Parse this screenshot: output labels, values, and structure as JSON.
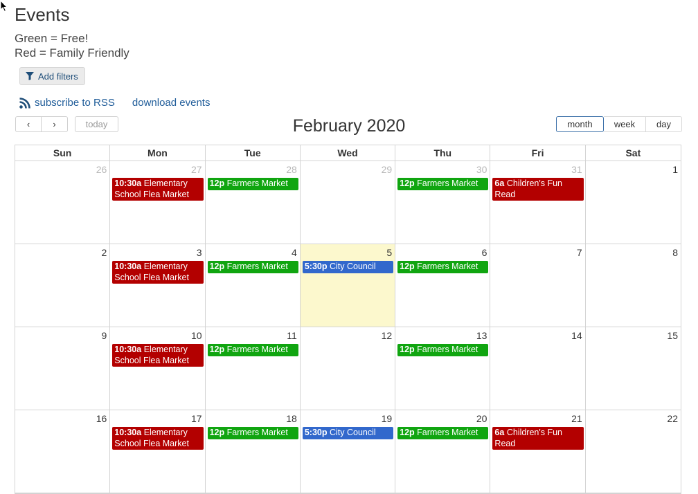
{
  "page": {
    "title": "Events",
    "legend": [
      "Green = Free!",
      "Red = Family Friendly"
    ],
    "add_filters_label": "Add filters",
    "subscribe_rss_label": "subscribe to RSS",
    "download_events_label": "download events"
  },
  "toolbar": {
    "prev_label": "‹",
    "next_label": "›",
    "today_label": "today",
    "title": "February 2020",
    "views": [
      "month",
      "week",
      "day"
    ],
    "active_view": "month"
  },
  "colors": {
    "family_friendly": "#b30000",
    "free": "#10a510",
    "default": "#3268cc",
    "today_highlight": "#fcf8cd"
  },
  "calendar": {
    "weekdays": [
      "Sun",
      "Mon",
      "Tue",
      "Wed",
      "Thu",
      "Fri",
      "Sat"
    ],
    "weeks": [
      [
        {
          "day": "26",
          "other": true,
          "events": []
        },
        {
          "day": "27",
          "other": true,
          "events": [
            {
              "time": "10:30a",
              "title": "Elementary School Flea Market",
              "color": "red"
            }
          ]
        },
        {
          "day": "28",
          "other": true,
          "events": [
            {
              "time": "12p",
              "title": "Farmers Market",
              "color": "green"
            }
          ]
        },
        {
          "day": "29",
          "other": true,
          "events": []
        },
        {
          "day": "30",
          "other": true,
          "events": [
            {
              "time": "12p",
              "title": "Farmers Market",
              "color": "green"
            }
          ]
        },
        {
          "day": "31",
          "other": true,
          "events": [
            {
              "time": "6a",
              "title": "Children's Fun Read",
              "color": "red"
            }
          ]
        },
        {
          "day": "1",
          "events": []
        }
      ],
      [
        {
          "day": "2",
          "events": []
        },
        {
          "day": "3",
          "events": [
            {
              "time": "10:30a",
              "title": "Elementary School Flea Market",
              "color": "red"
            }
          ]
        },
        {
          "day": "4",
          "events": [
            {
              "time": "12p",
              "title": "Farmers Market",
              "color": "green"
            }
          ]
        },
        {
          "day": "5",
          "today": true,
          "events": [
            {
              "time": "5:30p",
              "title": "City Council",
              "color": "blue"
            }
          ]
        },
        {
          "day": "6",
          "events": [
            {
              "time": "12p",
              "title": "Farmers Market",
              "color": "green"
            }
          ]
        },
        {
          "day": "7",
          "events": []
        },
        {
          "day": "8",
          "events": []
        }
      ],
      [
        {
          "day": "9",
          "events": []
        },
        {
          "day": "10",
          "events": [
            {
              "time": "10:30a",
              "title": "Elementary School Flea Market",
              "color": "red"
            }
          ]
        },
        {
          "day": "11",
          "events": [
            {
              "time": "12p",
              "title": "Farmers Market",
              "color": "green"
            }
          ]
        },
        {
          "day": "12",
          "events": []
        },
        {
          "day": "13",
          "events": [
            {
              "time": "12p",
              "title": "Farmers Market",
              "color": "green"
            }
          ]
        },
        {
          "day": "14",
          "events": []
        },
        {
          "day": "15",
          "events": []
        }
      ],
      [
        {
          "day": "16",
          "events": []
        },
        {
          "day": "17",
          "events": [
            {
              "time": "10:30a",
              "title": "Elementary School Flea Market",
              "color": "red"
            }
          ]
        },
        {
          "day": "18",
          "events": [
            {
              "time": "12p",
              "title": "Farmers Market",
              "color": "green"
            }
          ]
        },
        {
          "day": "19",
          "events": [
            {
              "time": "5:30p",
              "title": "City Council",
              "color": "blue"
            }
          ]
        },
        {
          "day": "20",
          "events": [
            {
              "time": "12p",
              "title": "Farmers Market",
              "color": "green"
            }
          ]
        },
        {
          "day": "21",
          "events": [
            {
              "time": "6a",
              "title": "Children's Fun Read",
              "color": "red"
            }
          ]
        },
        {
          "day": "22",
          "events": []
        }
      ]
    ]
  }
}
